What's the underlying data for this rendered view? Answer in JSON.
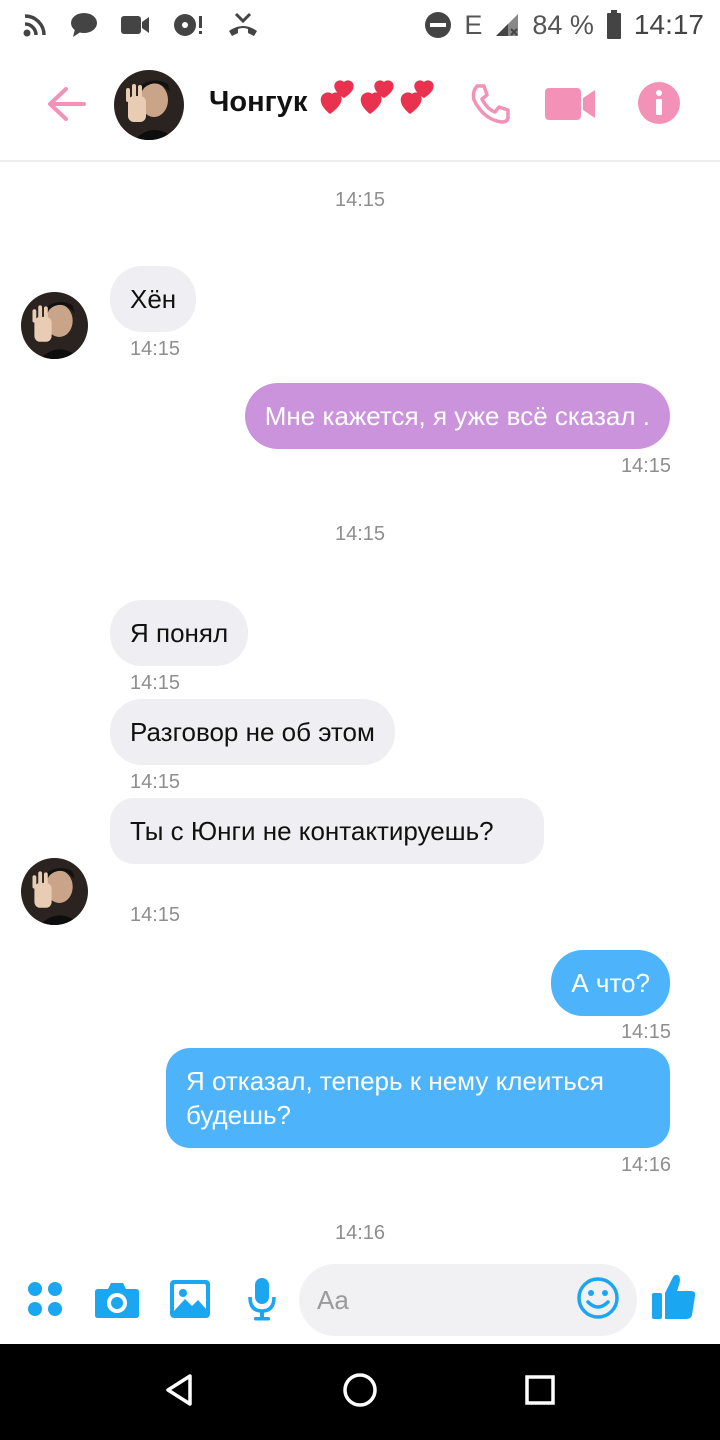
{
  "status_bar": {
    "network_label": "E",
    "battery_percent": "84 %",
    "time": "14:17"
  },
  "header": {
    "contact_name": "Чонгук",
    "hearts_emoji": "💕💕💕",
    "back_icon": "arrow-left-icon",
    "call_icon": "phone-icon",
    "video_icon": "video-camera-icon",
    "info_icon": "info-icon",
    "accent_color": "#f491b6"
  },
  "chat": {
    "separators": [
      "14:15",
      "14:15",
      "14:16"
    ],
    "messages": [
      {
        "direction": "in",
        "text": "Хён",
        "time": "14:15"
      },
      {
        "direction": "out",
        "text": "Мне кажется, я уже всё сказал .",
        "time": "14:15",
        "color": "#cb93dc"
      },
      {
        "direction": "in",
        "text": "Я понял",
        "time": "14:15"
      },
      {
        "direction": "in",
        "text": "Разговор не об этом",
        "time": "14:15"
      },
      {
        "direction": "in",
        "text": "Ты с Юнги не контактируешь?",
        "time": "14:15"
      },
      {
        "direction": "out",
        "text": "А что?",
        "time": "14:15",
        "color": "#4db4fb"
      },
      {
        "direction": "out",
        "text": "Я отказал, теперь к нему клеиться будешь?",
        "time": "14:16",
        "color": "#4db4fb"
      }
    ]
  },
  "composer": {
    "placeholder": "Aa",
    "icons": [
      "apps-icon",
      "camera-icon",
      "gallery-icon",
      "microphone-icon",
      "emoji-icon",
      "thumbs-up-icon"
    ],
    "accent_color": "#1aa6f0"
  },
  "nav_bar": {
    "icons": [
      "back-triangle-icon",
      "home-circle-icon",
      "recents-square-icon"
    ]
  }
}
